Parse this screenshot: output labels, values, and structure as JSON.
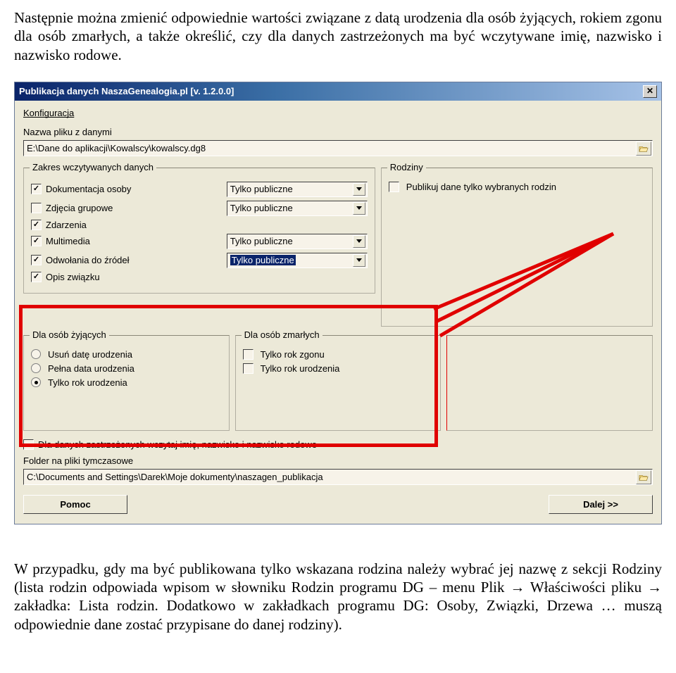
{
  "intro": "Następnie można zmienić odpowiednie wartości związane z datą urodzenia dla osób żyjących, rokiem zgonu dla osób zmarłych, a także określić, czy dla danych zastrzeżonych ma być wczytywane imię, nazwisko i nazwisko rodowe.",
  "dialog": {
    "title": "Publikacja danych NaszaGenealogia.pl [v. 1.2.0.0]",
    "menu": "Konfiguracja",
    "file_label": "Nazwa pliku z danymi",
    "file_path": "E:\\Dane do aplikacji\\Kowalscy\\kowalscy.dg8",
    "group_zakres_title": "Zakres wczytywanych danych",
    "group_rodziny_title": "Rodziny",
    "rodziny_check": "Publikuj dane tylko wybranych rodzin",
    "rows": [
      {
        "label": "Dokumentacja osoby",
        "dd": "Tylko publiczne",
        "checked": true,
        "has_dd": true
      },
      {
        "label": "Zdjęcia grupowe",
        "dd": "Tylko publiczne",
        "checked": false,
        "has_dd": true
      },
      {
        "label": "Zdarzenia",
        "dd": "",
        "checked": true,
        "has_dd": false
      },
      {
        "label": "Multimedia",
        "dd": "Tylko publiczne",
        "checked": true,
        "has_dd": true
      },
      {
        "label": "Odwołania do źródeł",
        "dd": "Tylko publiczne",
        "checked": true,
        "has_dd": true,
        "selected": true
      },
      {
        "label": "Opis związku",
        "dd": "",
        "checked": true,
        "has_dd": false
      }
    ],
    "group_living_title": "Dla osób żyjących",
    "group_dead_title": "Dla osób zmarłych",
    "living_opts": [
      {
        "label": "Usuń datę urodzenia",
        "selected": false
      },
      {
        "label": "Pełna data urodzenia",
        "selected": false
      },
      {
        "label": "Tylko rok urodzenia",
        "selected": true
      }
    ],
    "dead_opts": [
      {
        "label": "Tylko rok zgonu",
        "checked": false
      },
      {
        "label": "Tylko rok urodzenia",
        "checked": false
      }
    ],
    "restricted_check": "Dla danych zastrzeżonych wczytaj imię, nazwisko i nazwisko rodowe",
    "temp_label": "Folder na pliki tymczasowe",
    "temp_path": "C:\\Documents and Settings\\Darek\\Moje dokumenty\\naszagen_publikacja",
    "btn_help": "Pomoc",
    "btn_next": "Dalej  >>"
  },
  "caption": "W przypadku, gdy ma być publikowana tylko wskazana rodzina należy wybrać jej nazwę z sekcji Rodziny (lista rodzin odpowiada wpisom w słowniku Rodzin programu DG – menu Plik → Właściwości pliku → zakładka: Lista rodzin. Dodatkowo w zakładkach programu DG: Osoby, Związki, Drzewa … muszą odpowiednie dane zostać przypisane do danej rodziny)."
}
